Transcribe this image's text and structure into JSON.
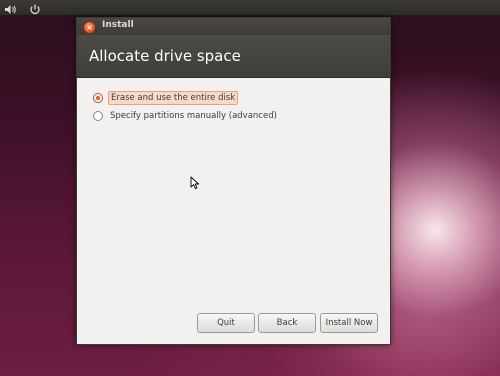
{
  "topbar": {
    "icons": [
      "volume-icon",
      "power-icon"
    ]
  },
  "window": {
    "title": "Install",
    "close_glyph": "×"
  },
  "page": {
    "title": "Allocate drive space"
  },
  "options": [
    {
      "label": "Erase and use the entire disk",
      "selected": true
    },
    {
      "label": "Specify partitions manually (advanced)",
      "selected": false
    }
  ],
  "buttons": {
    "quit": "Quit",
    "back": "Back",
    "install": "Install Now"
  },
  "colors": {
    "accent": "#e05c2a",
    "header_bg": "#3f3e3a",
    "panel_bg": "#f2f1f0"
  }
}
